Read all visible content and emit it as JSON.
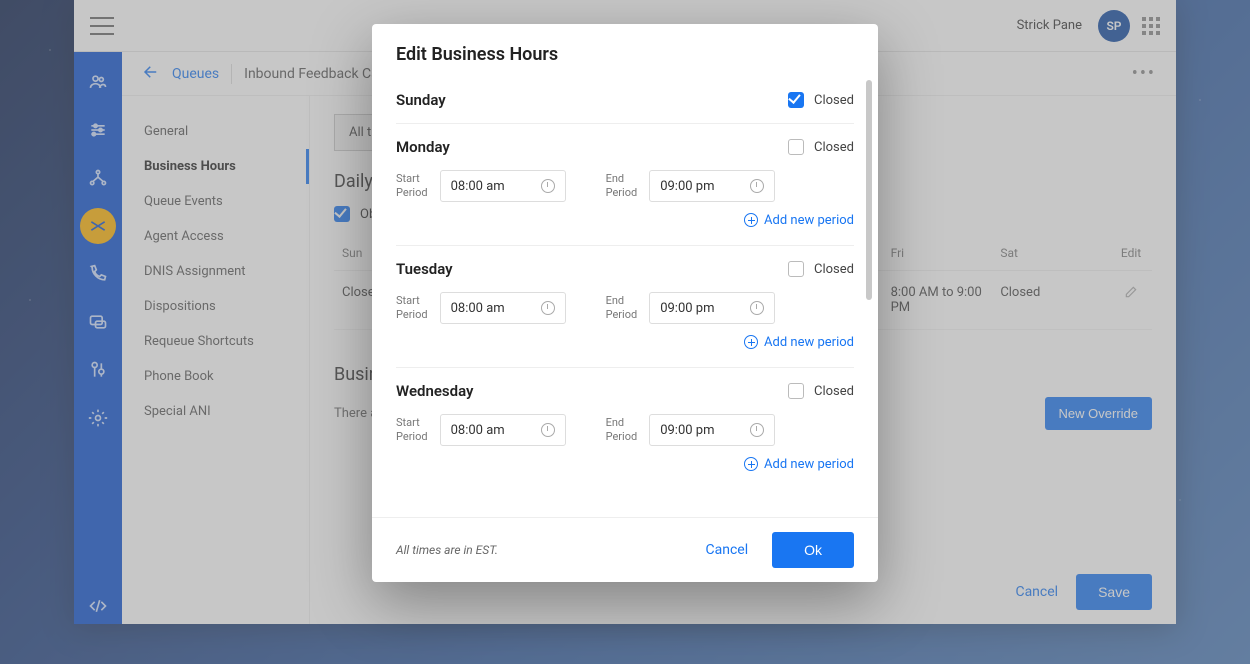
{
  "header": {
    "username": "Strick Pane",
    "avatar_initials": "SP"
  },
  "breadcrumb": {
    "back_label": "Queues",
    "current": "Inbound Feedback Calls"
  },
  "sidenav": {
    "items": [
      {
        "label": "General"
      },
      {
        "label": "Business Hours"
      },
      {
        "label": "Queue Events"
      },
      {
        "label": "Agent Access"
      },
      {
        "label": "DNIS Assignment"
      },
      {
        "label": "Dispositions"
      },
      {
        "label": "Requeue Shortcuts"
      },
      {
        "label": "Phone Book"
      },
      {
        "label": "Special ANI"
      }
    ],
    "active_index": 1
  },
  "panel": {
    "all_time_label": "All ti",
    "section_title": "Daily B",
    "observe_label": "Obs",
    "week_headers": {
      "sun": "Sun",
      "fri": "Fri",
      "sat": "Sat",
      "edit": "Edit"
    },
    "week_row": {
      "sun": "Closed",
      "fri": "8:00 AM to 9:00 PM",
      "sat": "Closed"
    },
    "overrides_title": "Busine",
    "no_overrides_text": "There ar",
    "new_override_label": "New Override",
    "cancel_label": "Cancel",
    "save_label": "Save"
  },
  "modal": {
    "title": "Edit Business Hours",
    "closed_label": "Closed",
    "start_label_l1": "Start",
    "start_label_l2": "Period",
    "end_label_l1": "End",
    "end_label_l2": "Period",
    "add_period_label": "Add new period",
    "tz_note": "All times are in EST.",
    "cancel_label": "Cancel",
    "ok_label": "Ok",
    "days": [
      {
        "name": "Sunday",
        "closed": true
      },
      {
        "name": "Monday",
        "closed": false,
        "start": "08:00 am",
        "end": "09:00 pm"
      },
      {
        "name": "Tuesday",
        "closed": false,
        "start": "08:00 am",
        "end": "09:00 pm"
      },
      {
        "name": "Wednesday",
        "closed": false,
        "start": "08:00 am",
        "end": "09:00 pm"
      }
    ]
  }
}
